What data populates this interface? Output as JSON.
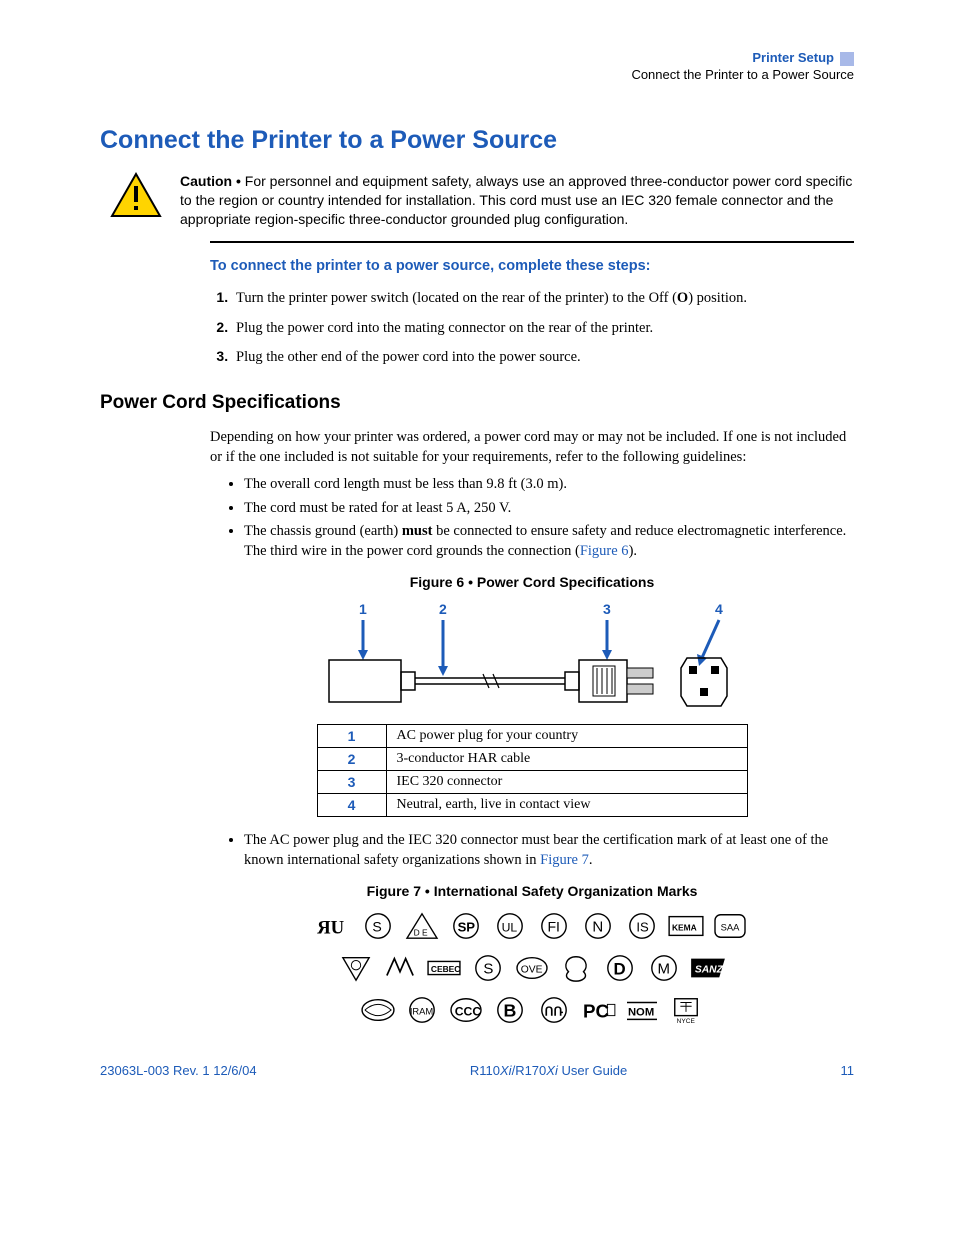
{
  "header": {
    "chapter": "Printer Setup",
    "section": "Connect the Printer to a Power Source"
  },
  "h1": "Connect the Printer to a Power Source",
  "caution": {
    "label": "Caution • ",
    "text": "For personnel and equipment safety, always use an approved three-conductor power cord specific to the region or country intended for installation. This cord must use an IEC 320 female connector and the appropriate region-specific three-conductor grounded plug configuration."
  },
  "steps_heading": "To connect the printer to a power source, complete these steps:",
  "steps": {
    "s1a": "Turn the printer power switch (located on the rear of the printer) to the Off (",
    "s1b": "O",
    "s1c": ") position.",
    "s2": "Plug the power cord into the mating connector on the rear of the printer.",
    "s3": "Plug the other end of the power cord into the power source."
  },
  "h2": "Power Cord Specifications",
  "spec_intro": "Depending on how your printer was ordered, a power cord may or may not be included. If one is not included or if the one included is not suitable for your requirements, refer to the following guidelines:",
  "bullets1": {
    "b1": "The overall cord length must be less than 9.8 ft (3.0 m).",
    "b2": "The cord must be rated for at least 5 A, 250 V.",
    "b3a": "The chassis ground (earth) ",
    "b3b": "must",
    "b3c": " be connected to ensure safety and reduce electromagnetic interference. The third wire in the power cord grounds the connection (",
    "b3link": "Figure 6",
    "b3d": ")."
  },
  "fig6": {
    "caption": "Figure 6 • Power Cord Specifications",
    "labels": {
      "l1": "1",
      "l2": "2",
      "l3": "3",
      "l4": "4"
    },
    "table": {
      "r1": {
        "n": "1",
        "d": "AC power plug for your country"
      },
      "r2": {
        "n": "2",
        "d": "3-conductor HAR cable"
      },
      "r3": {
        "n": "3",
        "d": "IEC 320 connector"
      },
      "r4": {
        "n": "4",
        "d": "Neutral, earth, live in contact view"
      }
    }
  },
  "bullets2": {
    "b1a": "The AC power plug and the IEC 320 connector must bear the certification mark of at least one of the known international safety organizations shown in ",
    "b1link": "Figure 7",
    "b1b": "."
  },
  "fig7": {
    "caption": "Figure 7 • International Safety Organization Marks"
  },
  "footer": {
    "left": "23063L-003 Rev. 1   12/6/04",
    "center_a": "R110",
    "center_b": "Xi",
    "center_c": "/R170",
    "center_d": "Xi",
    "center_e": " User Guide",
    "right": "11"
  }
}
